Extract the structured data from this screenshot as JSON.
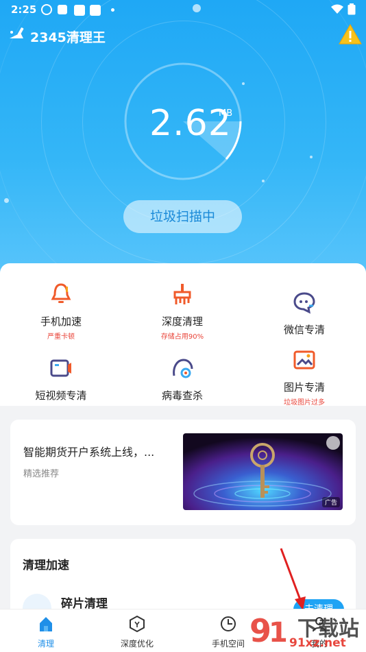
{
  "status_bar": {
    "time": "2:25"
  },
  "app": {
    "title": "2345清理王"
  },
  "scan": {
    "size_value": "2.62",
    "size_unit": "MB",
    "button_label": "垃圾扫描中"
  },
  "features": [
    {
      "label": "手机加速",
      "sub": "严重卡顿",
      "icon": "bell-rocket-icon",
      "color": "#f05a2a"
    },
    {
      "label": "深度清理",
      "sub": "存储占用90%",
      "icon": "broom-icon",
      "color": "#f05a2a"
    },
    {
      "label": "微信专清",
      "sub": "",
      "icon": "chat-bubble-icon",
      "color": "#4a4a8a"
    },
    {
      "label": "短视频专清",
      "sub": "",
      "icon": "video-icon",
      "color": "#4a4a8a"
    },
    {
      "label": "病毒查杀",
      "sub": "",
      "icon": "virus-shield-icon",
      "color": "#4a4a8a"
    },
    {
      "label": "图片专清",
      "sub": "垃圾图片过多",
      "icon": "image-icon",
      "color": "#f05a2a"
    }
  ],
  "ad": {
    "title": "智能期货开户系统上线，...",
    "subtitle": "精选推荐",
    "tag": "广告"
  },
  "clean_section": {
    "title": "清理加速",
    "item_label": "碎片清理",
    "button_label": "去清理"
  },
  "tabs": [
    {
      "label": "清理",
      "icon": "home-clean-icon",
      "active": true
    },
    {
      "label": "深度优化",
      "icon": "hexagon-icon",
      "active": false
    },
    {
      "label": "手机空间",
      "icon": "clock-pie-icon",
      "active": false
    },
    {
      "label": "我的",
      "icon": "user-icon",
      "active": false
    }
  ],
  "watermark": {
    "text": "下载站",
    "domain": "91xz.net"
  },
  "colors": {
    "accent": "#1fa8f5",
    "alert": "#e9463b"
  }
}
